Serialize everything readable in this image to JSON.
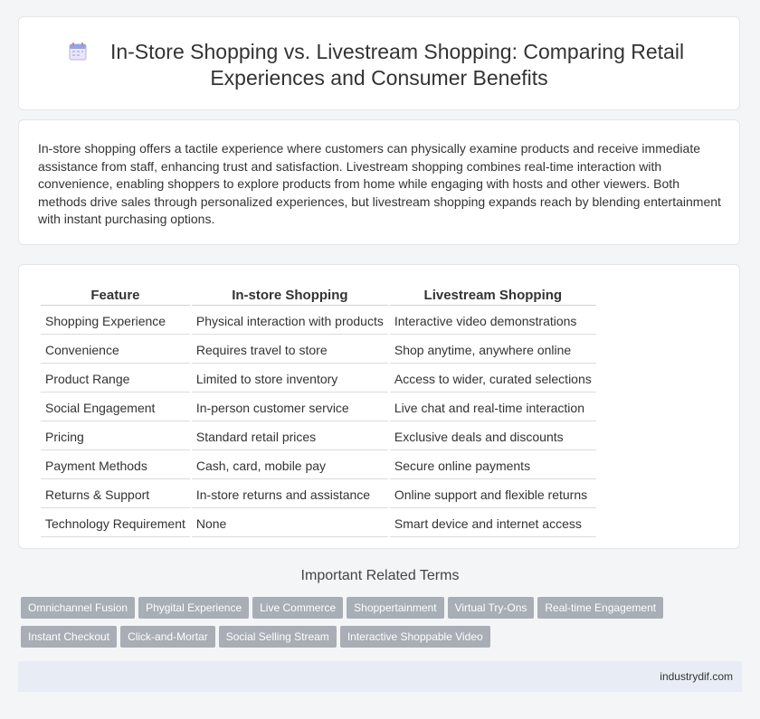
{
  "header": {
    "title_line1": "In-Store Shopping vs. Livestream Shopping: Comparing Retail",
    "title_line2": "Experiences and Consumer Benefits",
    "icon": "calendar-icon"
  },
  "intro": {
    "text": "In-store shopping offers a tactile experience where customers can physically examine products and receive immediate assistance from staff, enhancing trust and satisfaction. Livestream shopping combines real-time interaction with convenience, enabling shoppers to explore products from home while engaging with hosts and other viewers. Both methods drive sales through personalized experiences, but livestream shopping expands reach by blending entertainment with instant purchasing options."
  },
  "table": {
    "headers": [
      "Feature",
      "In-store Shopping",
      "Livestream Shopping"
    ],
    "rows": [
      [
        "Shopping Experience",
        "Physical interaction with products",
        "Interactive video demonstrations"
      ],
      [
        "Convenience",
        "Requires travel to store",
        "Shop anytime, anywhere online"
      ],
      [
        "Product Range",
        "Limited to store inventory",
        "Access to wider, curated selections"
      ],
      [
        "Social Engagement",
        "In-person customer service",
        "Live chat and real-time interaction"
      ],
      [
        "Pricing",
        "Standard retail prices",
        "Exclusive deals and discounts"
      ],
      [
        "Payment Methods",
        "Cash, card, mobile pay",
        "Secure online payments"
      ],
      [
        "Returns & Support",
        "In-store returns and assistance",
        "Online support and flexible returns"
      ],
      [
        "Technology Requirement",
        "None",
        "Smart device and internet access"
      ]
    ]
  },
  "related": {
    "title": "Important Related Terms",
    "tags": [
      "Omnichannel Fusion",
      "Phygital Experience",
      "Live Commerce",
      "Shoppertainment",
      "Virtual Try-Ons",
      "Real-time Engagement",
      "Instant Checkout",
      "Click-and-Mortar",
      "Social Selling Stream",
      "Interactive Shoppable Video"
    ]
  },
  "footer": {
    "site": "industrydif.com"
  },
  "colors": {
    "tag_bg": "#a8adb6",
    "footer_bg": "#e8edf5",
    "page_bg": "#f4f5f7"
  }
}
